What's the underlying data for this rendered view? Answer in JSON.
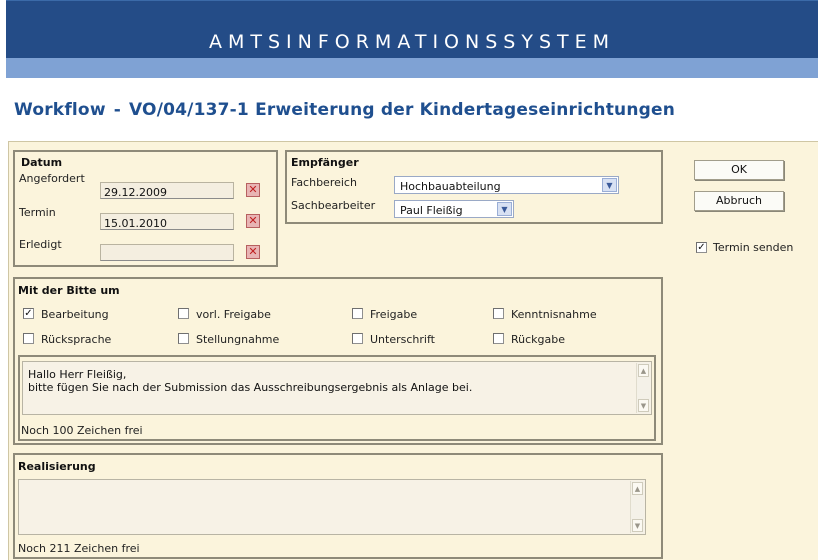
{
  "app": {
    "banner_title": "AMTSINFORMATIONSSYSTEM"
  },
  "page": {
    "prefix": "Workflow",
    "separator": "-",
    "title": "VO/04/137-1 Erweiterung der Kindertageseinrichtungen"
  },
  "datum": {
    "title": "Datum",
    "angefordert_label": "Angefordert",
    "angefordert_value": "29.12.2009",
    "termin_label": "Termin",
    "termin_value": "15.01.2010",
    "erledigt_label": "Erledigt",
    "erledigt_value": "",
    "clear_icon": "clear-date-icon"
  },
  "empfaenger": {
    "title": "Empfänger",
    "fachbereich_label": "Fachbereich",
    "fachbereich_value": "Hochbauabteilung",
    "sachbearbeiter_label": "Sachbearbeiter",
    "sachbearbeiter_value": "Paul Fleißig"
  },
  "actions": {
    "ok_label": "OK",
    "abbruch_label": "Abbruch",
    "termin_senden_label": "Termin senden",
    "termin_senden_checked": true
  },
  "bitte": {
    "title": "Mit der Bitte um",
    "options": [
      {
        "label": "Bearbeitung",
        "checked": true
      },
      {
        "label": "vorl. Freigabe",
        "checked": false
      },
      {
        "label": "Freigabe",
        "checked": false
      },
      {
        "label": "Kenntnisnahme",
        "checked": false
      },
      {
        "label": "Rücksprache",
        "checked": false
      },
      {
        "label": "Stellungnahme",
        "checked": false
      },
      {
        "label": "Unterschrift",
        "checked": false
      },
      {
        "label": "Rückgabe",
        "checked": false
      }
    ],
    "message_line1": "Hallo Herr Fleißig,",
    "message_line2": "bitte fügen Sie nach der Submission das Ausschreibungsergebnis als Anlage bei.",
    "counter": "Noch 100 Zeichen frei"
  },
  "realisierung": {
    "title": "Realisierung",
    "text": "",
    "counter": "Noch 211 Zeichen frei"
  },
  "colors": {
    "banner": "#244c87",
    "subbar": "#7fa2d4",
    "panel": "#fbf4dc",
    "title": "#1f4f8f"
  }
}
